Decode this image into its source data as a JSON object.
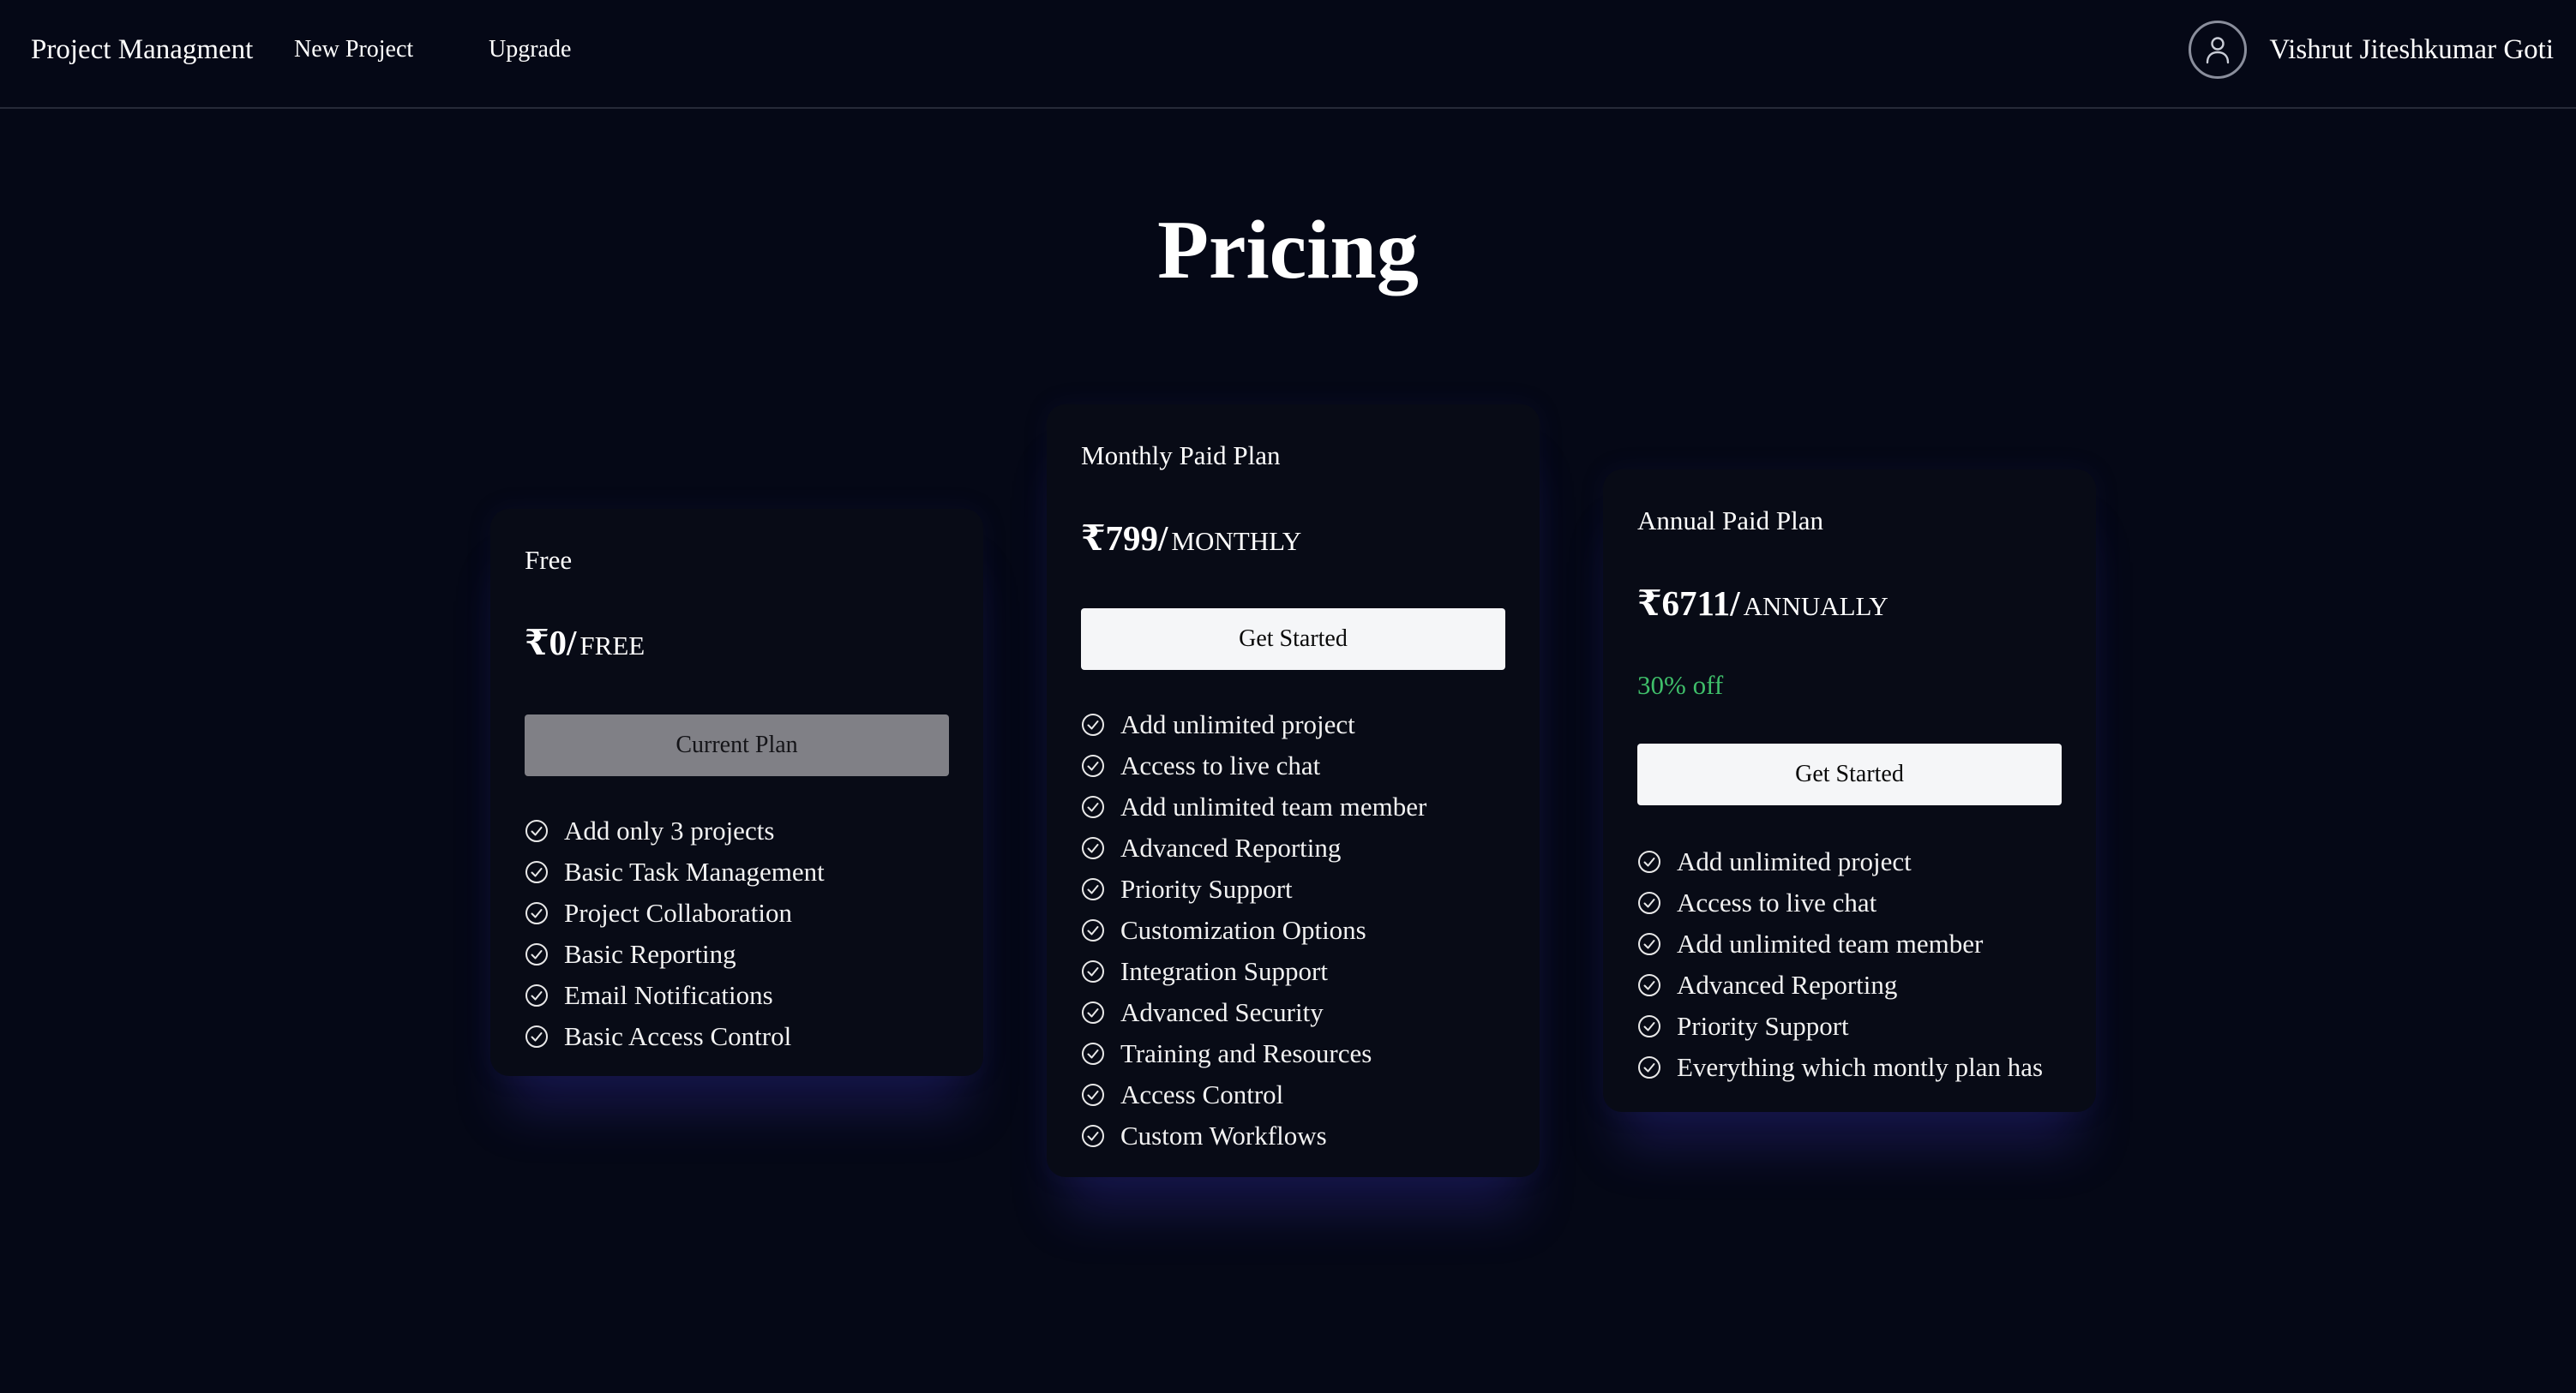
{
  "nav": {
    "brand": "Project Managment",
    "new_project": "New Project",
    "upgrade": "Upgrade",
    "user_name": "Vishrut Jiteshkumar Goti",
    "avatar_icon": "user-icon"
  },
  "page": {
    "title": "Pricing"
  },
  "plans": [
    {
      "name": "Free",
      "price": "₹0/",
      "period": "FREE",
      "button": "Current Plan",
      "features": [
        "Add only 3 projects",
        "Basic Task Management",
        "Project Collaboration",
        "Basic Reporting",
        "Email Notifications",
        "Basic Access Control"
      ]
    },
    {
      "name": "Monthly Paid Plan",
      "price": "₹799/",
      "period": "MONTHLY",
      "button": "Get Started",
      "features": [
        "Add unlimited project",
        "Access to live chat",
        "Add unlimited team member",
        "Advanced Reporting",
        "Priority Support",
        "Customization Options",
        "Integration Support",
        "Advanced Security",
        "Training and Resources",
        "Access Control",
        "Custom Workflows"
      ]
    },
    {
      "name": "Annual Paid Plan",
      "price": "₹6711/",
      "period": "ANNUALLY",
      "discount": "30% off",
      "button": "Get Started",
      "features": [
        "Add unlimited project",
        "Access to live chat",
        "Add unlimited team member",
        "Advanced Reporting",
        "Priority Support",
        "Everything which montly plan has"
      ]
    }
  ],
  "colors": {
    "background": "#050816",
    "card": "#080b16",
    "discount": "#3fbf6a",
    "current_plan_button": "#808086",
    "primary_button": "#f5f6f8"
  },
  "icons": {
    "feature_check": "check-circle-icon"
  }
}
